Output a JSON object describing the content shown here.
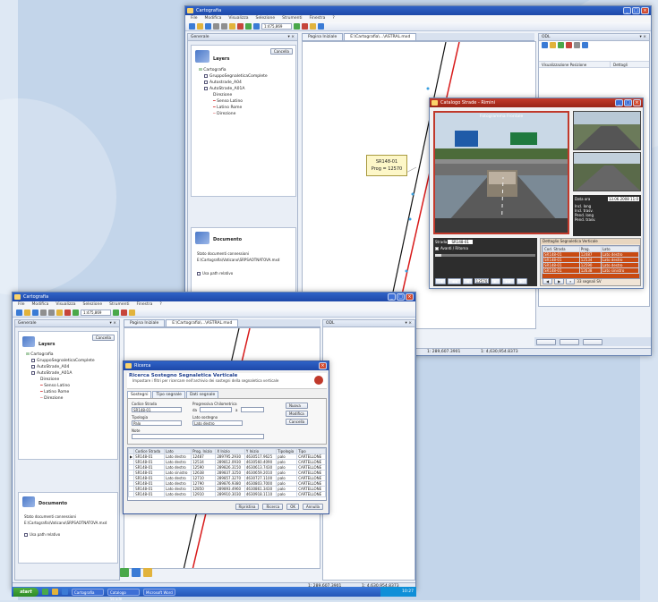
{
  "colors": {
    "title_bar": "#2356c0",
    "map_red_line": "#e02020",
    "signal_table_bg": "#c84a12",
    "start_button": "#3a9b33",
    "dialog_title": "#1f3f8f"
  },
  "back_window": {
    "title": "Cartografia",
    "menu": [
      "File",
      "Modifica",
      "Visualizza",
      "Selezione",
      "Strumenti",
      "Finestra",
      "?"
    ],
    "scale_combo": "1:475,869",
    "left_panel": {
      "header": "Generale",
      "layers_title": "Layers",
      "close_btn": "Cancella"
    },
    "layers_tree": [
      "Cartografia",
      "GruppoSegnaleticaComplete",
      "Autostrade_A04",
      "AutoStrade_A01A",
      "Direzione",
      "Senso Latino",
      "Latino Rome",
      "Direzione"
    ],
    "documents": {
      "title": "Documento",
      "label": "Stato documenti connessioni",
      "path": "E:\\Cartografia\\Vaticano\\SRPSAOTNATOVA.mxd",
      "checkbox": "Usa path relativo"
    },
    "map_tabs": [
      "Pagina Iniziale",
      "E:\\Cartografia\\...\\ASTRAL.mxd"
    ],
    "callout": {
      "line1": "SR148-01",
      "line2": "Prog = 12570"
    },
    "right_panel": {
      "header": "ODL",
      "col1": "Visualizzazione Posizione",
      "col2": "Dettagli"
    },
    "status": {
      "coords1": "1: 289,607.3901",
      "coords2": "1: 4,630,954.8373"
    }
  },
  "catalog_window": {
    "title": "Catalogo Strade - Rimini",
    "main_photo_caption": "Fotogramma Frontale",
    "data_label": "Data ora",
    "data_value": "13.06.2008 11:0",
    "stats": [
      "Incl. long",
      "Incl. trasv.",
      "Pend. long",
      "Pend. trasv."
    ],
    "strada_label": "Strada",
    "strada_value": "SR148-01",
    "avanti_label": "Avanti / Ritorna",
    "frame_counter": "12570",
    "signal_table_title": "Dettaglio Segnaletica Verticale",
    "signal_headers": [
      "Cod. Strada",
      "Prog.",
      "Lato"
    ],
    "signal_rows": [
      [
        "SR148-01",
        "12487",
        "Lato destro"
      ],
      [
        "SR148-01",
        "12534",
        "Lato destro"
      ],
      [
        "SR148-01",
        "12590",
        "Lato destro"
      ],
      [
        "SR148-01",
        "12638",
        "Lato sinistro"
      ],
      [
        "SR148-01",
        "12710",
        "Lato destro"
      ]
    ],
    "signal_footer": "33 segnali SV"
  },
  "front_window": {
    "title": "Cartografia",
    "menu": [
      "File",
      "Modifica",
      "Visualizza",
      "Selezione",
      "Strumenti",
      "Finestra",
      "?"
    ],
    "scale_combo": "1:475,869",
    "left_header": "Generale",
    "layers_title": "Layers",
    "close_btn": "Cancella",
    "layers_tree": [
      "Cartografia",
      "GruppoSegnaleticaComplete",
      "AutoStrade_A04",
      "AutoStrade_A01A",
      "Direzione",
      "Senso Latino",
      "Latino Rome",
      "Direzione"
    ],
    "documents": {
      "title": "Documento",
      "label": "Stato documenti connessioni",
      "path": "E:\\Cartografia\\Vaticano\\SRPSAOTNATOVA.mxd",
      "checkbox": "Usa path relativo"
    },
    "map_tabs": [
      "Pagina Iniziale",
      "E:\\Cartografia\\...\\ASTRAL.mxd"
    ],
    "status": {
      "coords1": "1: 289,607.3901",
      "coords2": "1: 4,630,954.8373"
    }
  },
  "dialog": {
    "title": "Ricerca",
    "heading": "Ricerca Sostegno Segnaletica Verticale",
    "subheading": "Impostare i filtri per ricercare nell'archivio dei sostegni della segnaletica verticale",
    "tabs": [
      "Sostegni",
      "Tipo segnale",
      "Dati segnale"
    ],
    "fields": {
      "cod_label": "Codice Strada",
      "cod_value": "SR148-01",
      "prog_label": "Progressiva Chilometrica",
      "da_label": "da",
      "a_label": "a",
      "tipologia_label": "Tipologia",
      "tipologia_value": "Palo",
      "lato_label": "Lato sostegno",
      "lato_value": "Lato destro",
      "note_label": "Note"
    },
    "side_buttons": [
      "Nuova",
      "Modifica",
      "Cancella"
    ],
    "grid_headers": [
      "Codice Strada",
      "Lato",
      "Prog. Inizio",
      "X Inizio",
      "Y Inizio",
      "Tipologia",
      "Tipo"
    ],
    "grid_rows": [
      [
        "SR148-01",
        "Lato destro",
        "12487",
        "289795.2930",
        "4630517.9625",
        "palo",
        "CARTELLONE"
      ],
      [
        "SR148-01",
        "Lato destro",
        "12534",
        "289812.0930",
        "4630560.4090",
        "palo",
        "CARTELLONE"
      ],
      [
        "SR148-01",
        "Lato destro",
        "12590",
        "289826.3150",
        "4630613.7430",
        "palo",
        "CARTELLONE"
      ],
      [
        "SR148-01",
        "Lato sinistro",
        "12638",
        "289837.3250",
        "4630659.2010",
        "palo",
        "CARTELLONE"
      ],
      [
        "SR148-01",
        "Lato destro",
        "12710",
        "289857.3270",
        "4630727.1100",
        "palo",
        "CARTELLONE"
      ],
      [
        "SR148-01",
        "Lato destro",
        "12790",
        "289876.9380",
        "4630803.7000",
        "palo",
        "CARTELLONE"
      ],
      [
        "SR148-01",
        "Lato destro",
        "12850",
        "289893.4960",
        "4630861.3430",
        "palo",
        "CARTELLONE"
      ],
      [
        "SR148-01",
        "Lato destro",
        "12910",
        "289910.3030",
        "4630918.1110",
        "palo",
        "CARTELLONE"
      ]
    ],
    "footer_buttons": [
      "Ripristina",
      "Ricerca",
      "OK",
      "Annulla"
    ]
  },
  "taskbar": {
    "start": "start",
    "tasks": [
      "Cartografia",
      "Catalogo Strade",
      "Microsoft Word"
    ],
    "clock": "10:27"
  }
}
